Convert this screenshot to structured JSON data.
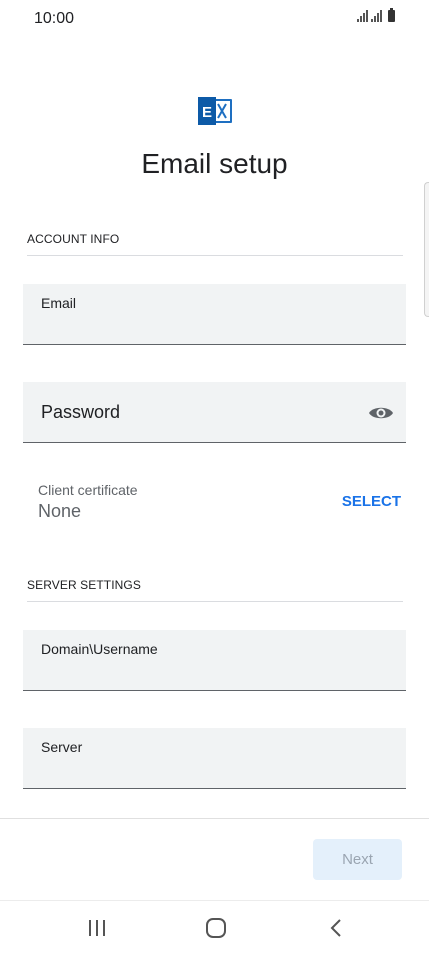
{
  "status_bar": {
    "time": "10:00"
  },
  "app": {
    "logo_icon": "exchange-icon",
    "title": "Email setup",
    "accent_color": "#1a73e8"
  },
  "account_info": {
    "header": "ACCOUNT INFO",
    "email": {
      "label": "Email",
      "value": ""
    },
    "password": {
      "label": "Password",
      "value": ""
    },
    "client_certificate": {
      "label": "Client certificate",
      "value": "None",
      "action_label": "SELECT"
    }
  },
  "server_settings": {
    "header": "SERVER SETTINGS",
    "domain_username": {
      "label": "Domain\\Username",
      "value": ""
    },
    "server": {
      "label": "Server",
      "value": ""
    }
  },
  "footer": {
    "next_label": "Next"
  },
  "nav_bar": {
    "recents_icon": "recents-icon",
    "home_icon": "home-icon",
    "back_icon": "back-icon"
  }
}
